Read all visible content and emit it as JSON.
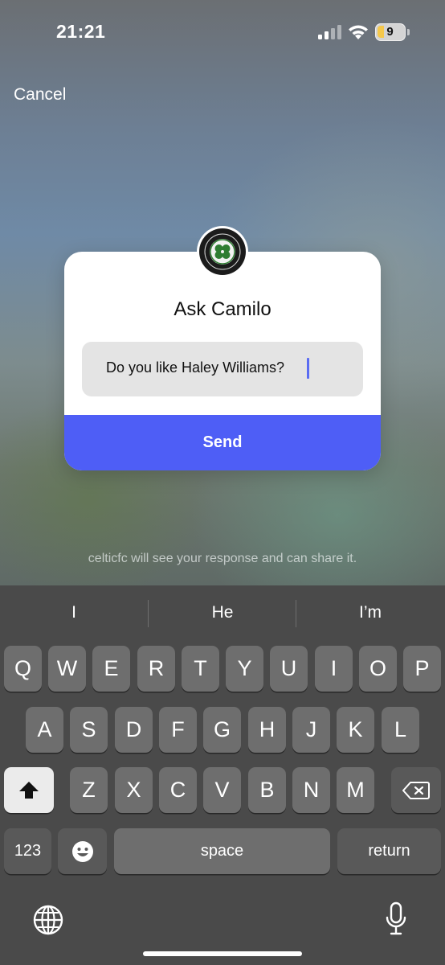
{
  "status": {
    "time": "21:21",
    "battery": "9"
  },
  "header": {
    "cancel_label": "Cancel"
  },
  "card": {
    "title": "Ask Camilo",
    "question": "Do you like Haley Williams?",
    "send_label": "Send"
  },
  "notice": "celticfc will see your response and can share it.",
  "keyboard": {
    "suggestions": [
      "I",
      "He",
      "I’m"
    ],
    "row1": [
      "Q",
      "W",
      "E",
      "R",
      "T",
      "Y",
      "U",
      "I",
      "O",
      "P"
    ],
    "row2": [
      "A",
      "S",
      "D",
      "F",
      "G",
      "H",
      "J",
      "K",
      "L"
    ],
    "row3": [
      "Z",
      "X",
      "C",
      "V",
      "B",
      "N",
      "M"
    ],
    "numbers_label": "123",
    "space_label": "space",
    "return_label": "return"
  },
  "icons": {
    "signal": "cellular-signal-icon",
    "wifi": "wifi-icon",
    "battery": "battery-icon",
    "avatar": "celtic-fc-crest",
    "shift": "shift-icon",
    "delete": "delete-icon",
    "emoji": "emoji-icon",
    "globe": "globe-icon",
    "mic": "microphone-icon"
  },
  "colors": {
    "accent": "#4e5ef6",
    "caret": "#5a6cf2",
    "battery_fill": "#f5c84b"
  }
}
